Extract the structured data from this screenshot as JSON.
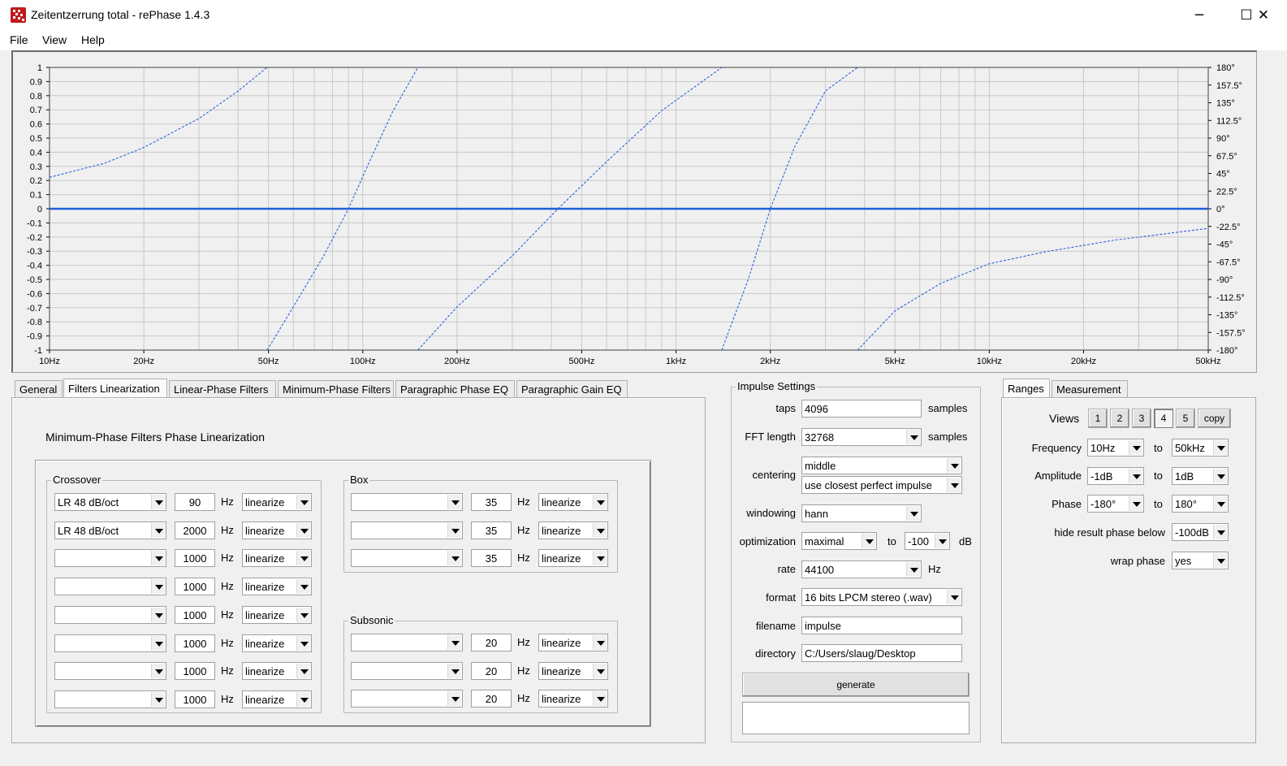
{
  "window": {
    "title": "Zeitentzerrung total  -  rePhase 1.4.3",
    "minimize": "─",
    "maximize": "☐",
    "close": "✕"
  },
  "menu": [
    "File",
    "View",
    "Help"
  ],
  "chart": {
    "y_left_ticks": [
      "1",
      "0.9",
      "0.8",
      "0.7",
      "0.6",
      "0.5",
      "0.4",
      "0.3",
      "0.2",
      "0.1",
      "0",
      "-0.1",
      "-0.2",
      "-0.3",
      "-0.4",
      "-0.5",
      "-0.6",
      "-0.7",
      "-0.8",
      "-0.9",
      "-1"
    ],
    "y_right_ticks": [
      "180°",
      "157.5°",
      "135°",
      "112.5°",
      "90°",
      "67.5°",
      "45°",
      "22.5°",
      "0°",
      "-22.5°",
      "-45°",
      "-67.5°",
      "-90°",
      "-112.5°",
      "-135°",
      "-157.5°",
      "-180°"
    ],
    "x_ticks": [
      {
        "label": "10Hz",
        "f": 10
      },
      {
        "label": "20Hz",
        "f": 20
      },
      {
        "label": "50Hz",
        "f": 50
      },
      {
        "label": "100Hz",
        "f": 100
      },
      {
        "label": "200Hz",
        "f": 200
      },
      {
        "label": "500Hz",
        "f": 500
      },
      {
        "label": "1kHz",
        "f": 1000
      },
      {
        "label": "2kHz",
        "f": 2000
      },
      {
        "label": "5kHz",
        "f": 5000
      },
      {
        "label": "10kHz",
        "f": 10000
      },
      {
        "label": "20kHz",
        "f": 20000
      },
      {
        "label": "50kHz",
        "f": 50000
      }
    ],
    "colors": {
      "amplitude": "#1f5fd6",
      "phase": "#2a62e0",
      "grid": "#c8c8c8"
    }
  },
  "chart_data": {
    "type": "line",
    "x_scale": "log",
    "xlim": [
      10,
      50000
    ],
    "ylim_left": [
      -1,
      1
    ],
    "ylim_right_deg": [
      -180,
      180
    ],
    "grid": true,
    "series": [
      {
        "style": "solid",
        "axis": "left",
        "x": [
          10,
          50000
        ],
        "y": [
          0,
          0
        ]
      },
      {
        "style": "dashed",
        "axis": "right",
        "x": [
          10,
          15,
          20,
          30,
          40,
          49.5
        ],
        "y": [
          40,
          58,
          78,
          115,
          150,
          180
        ]
      },
      {
        "style": "dashed",
        "axis": "right",
        "x": [
          49.5,
          60,
          75,
          90,
          105,
          125,
          150
        ],
        "y": [
          -180,
          -125,
          -60,
          0,
          60,
          125,
          180
        ]
      },
      {
        "style": "dashed",
        "axis": "right",
        "x": [
          150,
          200,
          300,
          420,
          600,
          900,
          1400
        ],
        "y": [
          -180,
          -125,
          -60,
          0,
          60,
          125,
          180
        ]
      },
      {
        "style": "dashed",
        "axis": "right",
        "x": [
          1400,
          1700,
          2000,
          2400,
          3000,
          3800
        ],
        "y": [
          -180,
          -90,
          0,
          80,
          150,
          180
        ]
      },
      {
        "style": "dashed",
        "axis": "right",
        "x": [
          3800,
          5000,
          7000,
          10000,
          15000,
          25000,
          50000
        ],
        "y": [
          -180,
          -130,
          -95,
          -70,
          -55,
          -40,
          -25
        ]
      }
    ]
  },
  "tabs": [
    "General",
    "Filters Linearization",
    "Linear-Phase Filters",
    "Minimum-Phase Filters",
    "Paragraphic Phase EQ",
    "Paragraphic Gain EQ"
  ],
  "section_title": "Minimum-Phase Filters Phase Linearization",
  "hz": "Hz",
  "crossover": {
    "label": "Crossover",
    "rows": [
      {
        "type": "LR  48 dB/oct",
        "freq": "90",
        "mode": "linearize"
      },
      {
        "type": "LR  48 dB/oct",
        "freq": "2000",
        "mode": "linearize"
      },
      {
        "type": "",
        "freq": "1000",
        "mode": "linearize"
      },
      {
        "type": "",
        "freq": "1000",
        "mode": "linearize"
      },
      {
        "type": "",
        "freq": "1000",
        "mode": "linearize"
      },
      {
        "type": "",
        "freq": "1000",
        "mode": "linearize"
      },
      {
        "type": "",
        "freq": "1000",
        "mode": "linearize"
      },
      {
        "type": "",
        "freq": "1000",
        "mode": "linearize"
      }
    ]
  },
  "box": {
    "label": "Box",
    "rows": [
      {
        "type": "",
        "freq": "35",
        "mode": "linearize"
      },
      {
        "type": "",
        "freq": "35",
        "mode": "linearize"
      },
      {
        "type": "",
        "freq": "35",
        "mode": "linearize"
      }
    ]
  },
  "subsonic": {
    "label": "Subsonic",
    "rows": [
      {
        "type": "",
        "freq": "20",
        "mode": "linearize"
      },
      {
        "type": "",
        "freq": "20",
        "mode": "linearize"
      },
      {
        "type": "",
        "freq": "20",
        "mode": "linearize"
      }
    ]
  },
  "impulse": {
    "label": "Impulse Settings",
    "taps_label": "taps",
    "taps": "4096",
    "samples": "samples",
    "fft_label": "FFT length",
    "fft": "32768",
    "centering_label": "centering",
    "centering": "middle",
    "centering2": "use closest perfect impulse",
    "windowing_label": "windowing",
    "windowing": "hann",
    "optimization_label": "optimization",
    "optimization": "maximal",
    "to": "to",
    "opt_db": "-100",
    "db": "dB",
    "rate_label": "rate",
    "rate": "44100",
    "rate_unit": "Hz",
    "format_label": "format",
    "format": "16 bits LPCM stereo (.wav)",
    "filename_label": "filename",
    "filename": "impulse",
    "directory_label": "directory",
    "directory": "C:/Users/slaug/Desktop",
    "generate": "generate",
    "status": ""
  },
  "ranges": {
    "tabs": [
      "Ranges",
      "Measurement"
    ],
    "views_label": "Views",
    "views": [
      "1",
      "2",
      "3",
      "4",
      "5",
      "copy"
    ],
    "frequency_label": "Frequency",
    "freq_from": "10Hz",
    "freq_to": "50kHz",
    "amplitude_label": "Amplitude",
    "amp_from": "-1dB",
    "amp_to": "1dB",
    "phase_label": "Phase",
    "phase_from": "-180°",
    "phase_to": "180°",
    "to": "to",
    "hide_label": "hide result phase below",
    "hide_value": "-100dB",
    "wrap_label": "wrap phase",
    "wrap_value": "yes"
  }
}
